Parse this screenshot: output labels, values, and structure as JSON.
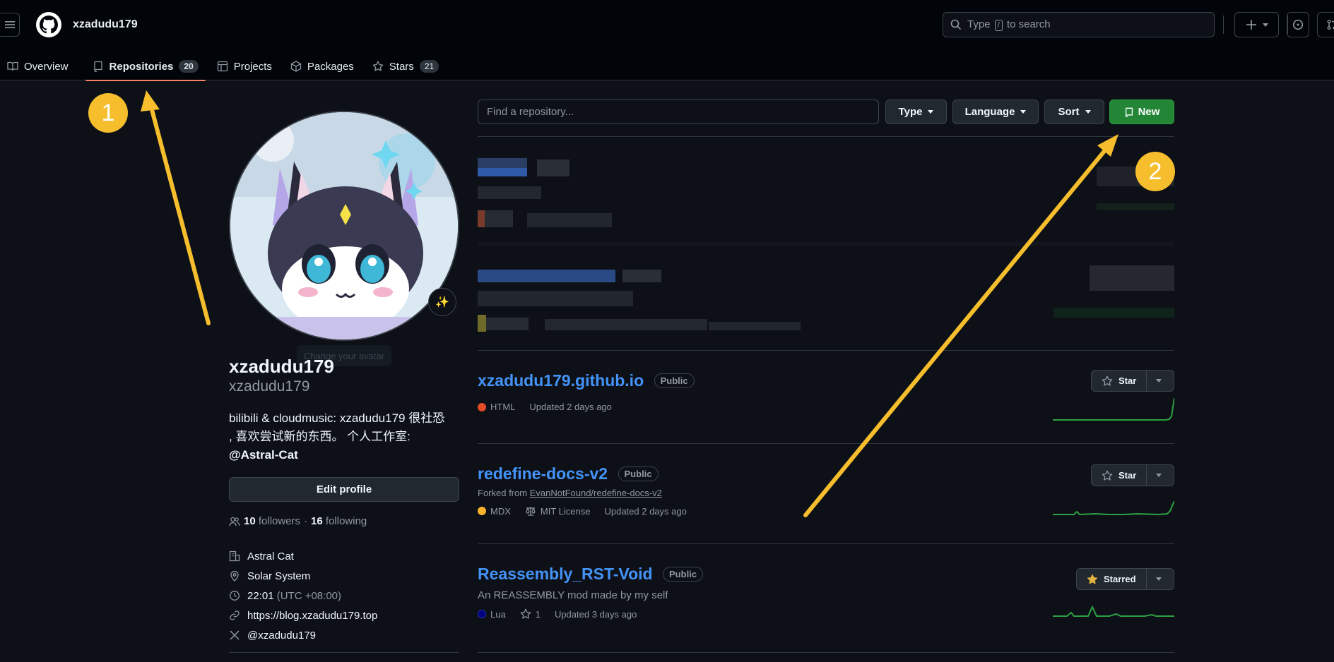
{
  "header": {
    "username": "xzadudu179",
    "search": {
      "prefix": "Type",
      "key": "/",
      "suffix": "to search"
    }
  },
  "tabs": [
    {
      "label": "Overview",
      "icon": "book-icon"
    },
    {
      "label": "Repositories",
      "count": "20",
      "icon": "repo-icon",
      "active": true
    },
    {
      "label": "Projects",
      "icon": "table-icon"
    },
    {
      "label": "Packages",
      "icon": "package-icon"
    },
    {
      "label": "Stars",
      "count": "21",
      "icon": "star-icon"
    }
  ],
  "profile": {
    "change_avatar": "Change your avatar",
    "name": "xzadudu179",
    "login": "xzadudu179",
    "bio_line1": "bilibili & cloudmusic: xzadudu179 很社恐",
    "bio_line2": ", 喜欢尝试新的东西。 个人工作室:",
    "bio_mention": "@Astral-Cat",
    "edit_label": "Edit profile",
    "followers_count": "10",
    "followers_label": "followers",
    "separator": "·",
    "following_count": "16",
    "following_label": "following",
    "details": [
      {
        "icon": "organization-icon",
        "text": "Astral Cat"
      },
      {
        "icon": "location-icon",
        "text": "Solar System"
      },
      {
        "icon": "clock-icon",
        "text": "22:01",
        "muted": "(UTC +08:00)"
      },
      {
        "icon": "link-icon",
        "text": "https://blog.xzadudu179.top"
      },
      {
        "icon": "x-icon",
        "text": "@xzadudu179"
      }
    ]
  },
  "repo_toolbar": {
    "find_placeholder": "Find a repository...",
    "type_label": "Type",
    "language_label": "Language",
    "sort_label": "Sort",
    "new_label": "New"
  },
  "repos": [
    {
      "name": "xzadudu179.github.io",
      "visibility": "Public",
      "language": "HTML",
      "language_color": "#e34c26",
      "updated": "Updated 2 days ago",
      "star_label": "Star"
    },
    {
      "name": "redefine-docs-v2",
      "visibility": "Public",
      "fork_prefix": "Forked from",
      "fork_source": "EvanNotFound/redefine-docs-v2",
      "language": "MDX",
      "language_color": "#fcb32c",
      "license": "MIT License",
      "updated": "Updated 2 days ago",
      "star_label": "Star"
    },
    {
      "name": "Reassembly_RST-Void",
      "visibility": "Public",
      "description": "An REASSEMBLY mod made by my self",
      "language": "Lua",
      "language_color": "#000080",
      "stars": "1",
      "updated": "Updated 3 days ago",
      "star_label": "Starred"
    }
  ],
  "annotations": {
    "callout1": "1",
    "callout2": "2",
    "color": "#f6be2c"
  }
}
